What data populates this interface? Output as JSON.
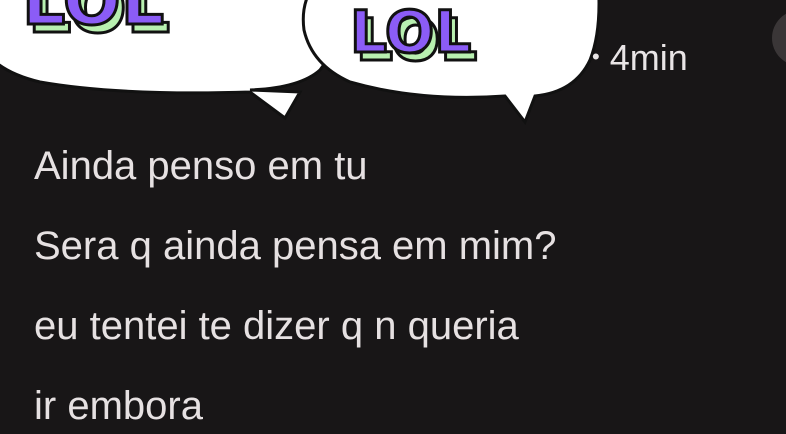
{
  "sticker": {
    "word_left": "LOL",
    "word_right": "LOL",
    "icon": "lol-speech-bubbles-sticker"
  },
  "post": {
    "dot": "•",
    "time": "4min"
  },
  "message": {
    "lines": [
      "Ainda penso em tu",
      "Sera q ainda pensa em mim?",
      "eu tentei te dizer q n queria",
      "ir embora"
    ]
  },
  "colors": {
    "background": "#181617",
    "text": "#e6e1e2",
    "bubble": "#ffffff",
    "sticker_purple": "#8b5cf6",
    "sticker_green": "#b8f0b0"
  }
}
